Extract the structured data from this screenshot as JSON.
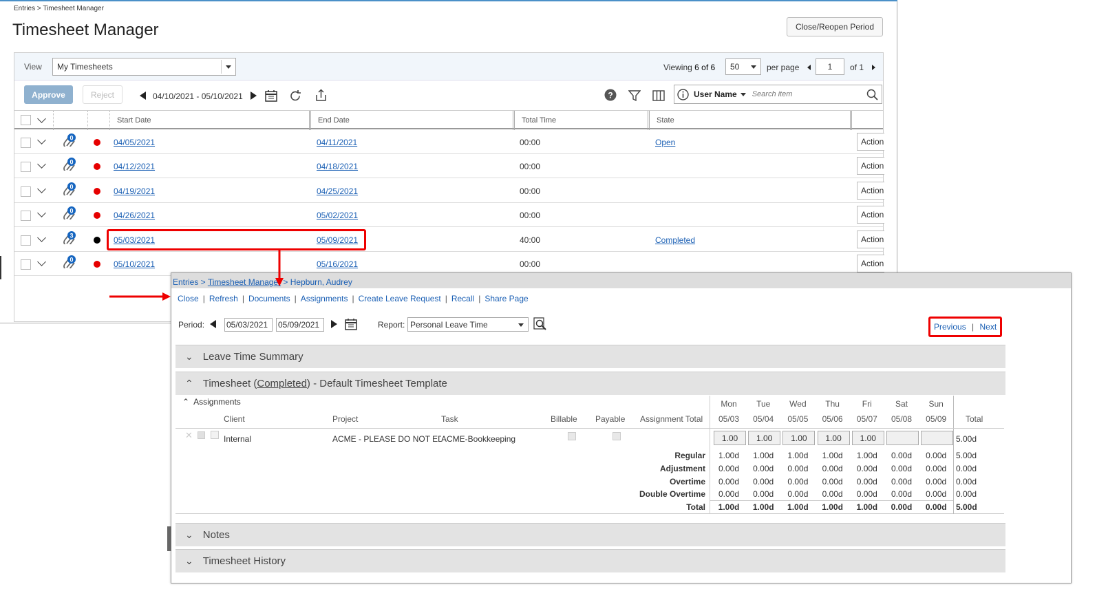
{
  "breadcrumb": "Entries > Timesheet Manager",
  "title": "Timesheet Manager",
  "close_reopen_label": "Close/Reopen Period",
  "view": {
    "label": "View",
    "value": "My Timesheets"
  },
  "paging": {
    "viewing_prefix": "Viewing",
    "viewing_count": "6 of 6",
    "per_page_value": "50",
    "per_page_label": "per page",
    "page": "1",
    "of_label": "of 1"
  },
  "toolbar": {
    "approve": "Approve",
    "reject": "Reject",
    "date_range": "04/10/2021 - 05/10/2021",
    "user_filter": "User Name",
    "search_placeholder": "Search item"
  },
  "columns": {
    "start": "Start Date",
    "end": "End Date",
    "total": "Total Time",
    "state": "State"
  },
  "rows": [
    {
      "badge": "0",
      "dot": "#e60000",
      "start": "04/05/2021",
      "end": "04/11/2021",
      "total": "00:00",
      "state": "Open",
      "action": "Action"
    },
    {
      "badge": "0",
      "dot": "#e60000",
      "start": "04/12/2021",
      "end": "04/18/2021",
      "total": "00:00",
      "state": "",
      "action": "Action"
    },
    {
      "badge": "0",
      "dot": "#e60000",
      "start": "04/19/2021",
      "end": "04/25/2021",
      "total": "00:00",
      "state": "",
      "action": "Action"
    },
    {
      "badge": "0",
      "dot": "#e60000",
      "start": "04/26/2021",
      "end": "05/02/2021",
      "total": "00:00",
      "state": "",
      "action": "Action"
    },
    {
      "badge": "3",
      "dot": "#000000",
      "start": "05/03/2021",
      "end": "05/09/2021",
      "total": "40:00",
      "state": "Completed",
      "action": "Action"
    },
    {
      "badge": "0",
      "dot": "#e60000",
      "start": "05/10/2021",
      "end": "05/16/2021",
      "total": "00:00",
      "state": "",
      "action": "Action"
    }
  ],
  "detail": {
    "crumb_entries": "Entries > ",
    "crumb_manager": "Timesheet Manager",
    "crumb_user": " > Hepburn, Audrey",
    "links": [
      "Close",
      "Refresh",
      "Documents",
      "Assignments",
      "Create Leave Request",
      "Recall",
      "Share Page"
    ],
    "period_label": "Period:",
    "period_start": "05/03/2021",
    "period_end": "05/09/2021",
    "report_label": "Report:",
    "report_value": "Personal Leave Time",
    "previous": "Previous",
    "next": "Next",
    "sep": "|",
    "leave_summary": "Leave Time Summary",
    "timesheet_prefix": "Timesheet (",
    "timesheet_state": "Completed",
    "timesheet_suffix": ")  - Default Timesheet Template",
    "assignments_label": "Assignments",
    "headers": {
      "client": "Client",
      "project": "Project",
      "task": "Task",
      "billable": "Billable",
      "payable": "Payable",
      "assignment_total": "Assignment Total",
      "total": "Total"
    },
    "days": [
      {
        "name": "Mon",
        "date": "05/03"
      },
      {
        "name": "Tue",
        "date": "05/04"
      },
      {
        "name": "Wed",
        "date": "05/05"
      },
      {
        "name": "Thu",
        "date": "05/06"
      },
      {
        "name": "Fri",
        "date": "05/07"
      },
      {
        "name": "Sat",
        "date": "05/08"
      },
      {
        "name": "Sun",
        "date": "05/09"
      }
    ],
    "assignment": {
      "client": "Internal",
      "project": "ACME - PLEASE DO NOT EDIT",
      "task": "ACME-Bookkeeping",
      "hours": [
        "1.00",
        "1.00",
        "1.00",
        "1.00",
        "1.00",
        "",
        ""
      ],
      "total": "5.00d"
    },
    "summary": [
      {
        "label": "Regular",
        "values": [
          "1.00d",
          "1.00d",
          "1.00d",
          "1.00d",
          "1.00d",
          "0.00d",
          "0.00d"
        ],
        "total": "5.00d"
      },
      {
        "label": "Adjustment",
        "values": [
          "0.00d",
          "0.00d",
          "0.00d",
          "0.00d",
          "0.00d",
          "0.00d",
          "0.00d"
        ],
        "total": "0.00d"
      },
      {
        "label": "Overtime",
        "values": [
          "0.00d",
          "0.00d",
          "0.00d",
          "0.00d",
          "0.00d",
          "0.00d",
          "0.00d"
        ],
        "total": "0.00d"
      },
      {
        "label": "Double Overtime",
        "values": [
          "0.00d",
          "0.00d",
          "0.00d",
          "0.00d",
          "0.00d",
          "0.00d",
          "0.00d"
        ],
        "total": "0.00d"
      },
      {
        "label": "Total",
        "values": [
          "1.00d",
          "1.00d",
          "1.00d",
          "1.00d",
          "1.00d",
          "0.00d",
          "0.00d"
        ],
        "total": "5.00d"
      }
    ],
    "notes": "Notes",
    "history": "Timesheet History"
  }
}
